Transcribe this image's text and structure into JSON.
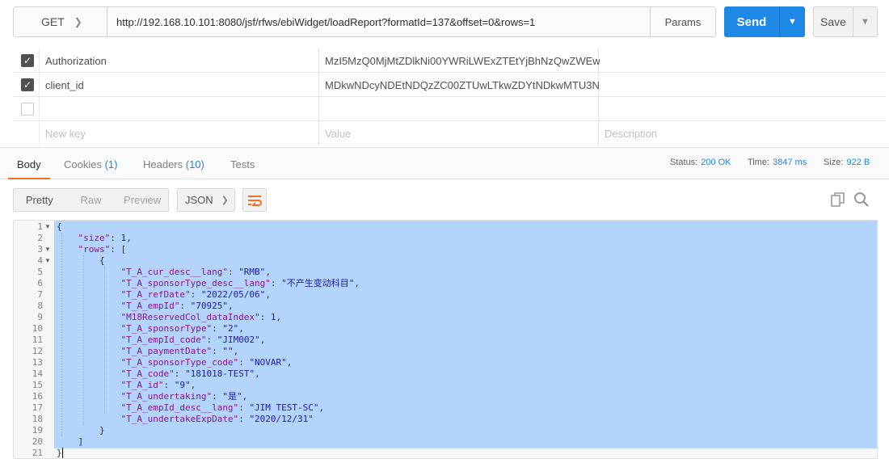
{
  "request": {
    "method": "GET",
    "url": "http://192.168.10.101:8080/jsf/rfws/ebiWidget/loadReport?formatId=137&offset=0&rows=1",
    "params_label": "Params",
    "send_label": "Send",
    "save_label": "Save"
  },
  "headers": [
    {
      "checked": true,
      "key": "Authorization",
      "value": "MzI5MzQ0MjMtZDlkNi00YWRiLWExZTEtYjBhNzQwZWEw..."
    },
    {
      "checked": true,
      "key": "client_id",
      "value": "MDkwNDcyNDEtNDQzZC00ZTUwLTkwZDYtNDkwMTU3N..."
    },
    {
      "checked": false,
      "key": "",
      "value": ""
    }
  ],
  "headers_placeholder": {
    "key": "New key",
    "value": "Value",
    "description": "Description"
  },
  "response_tabs": [
    {
      "label": "Body",
      "count": ""
    },
    {
      "label": "Cookies",
      "count": "(1)"
    },
    {
      "label": "Headers",
      "count": "(10)"
    },
    {
      "label": "Tests",
      "count": ""
    }
  ],
  "status": {
    "status_label": "Status:",
    "status_value": "200 OK",
    "time_label": "Time:",
    "time_value": "3847 ms",
    "size_label": "Size:",
    "size_value": "922 B"
  },
  "view_modes": [
    "Pretty",
    "Raw",
    "Preview"
  ],
  "format": "JSON",
  "icons": {
    "wrap": "wrap-lines-icon",
    "copy": "copy-icon",
    "search": "search-icon"
  },
  "colors": {
    "accent": "#1e88e5",
    "tab_indicator": "#f47023",
    "selection": "#b3d4fc",
    "json_key": "#881391",
    "json_value": "#1a1aa6"
  },
  "code_lines": [
    "{",
    "    \"size\": 1,",
    "    \"rows\": [",
    "        {",
    "            \"T_A_cur_desc__lang\": \"RMB\",",
    "            \"T_A_sponsorType_desc__lang\": \"不产生变动科目\",",
    "            \"T_A_refDate\": \"2022/05/06\",",
    "            \"T_A_empId\": \"70925\",",
    "            \"M18ReservedCol_dataIndex\": 1,",
    "            \"T_A_sponsorType\": \"2\",",
    "            \"T_A_empId_code\": \"JIM002\",",
    "            \"T_A_paymentDate\": \"\",",
    "            \"T_A_sponsorType_code\": \"NOVAR\",",
    "            \"T_A_code\": \"181018-TEST\",",
    "            \"T_A_id\": \"9\",",
    "            \"T_A_undertaking\": \"是\",",
    "            \"T_A_empId_desc__lang\": \"JIM TEST-SC\",",
    "            \"T_A_undertakeExpDate\": \"2020/12/31\"",
    "        }",
    "    ]",
    "}"
  ],
  "folded_lines": [
    1,
    3,
    4
  ]
}
